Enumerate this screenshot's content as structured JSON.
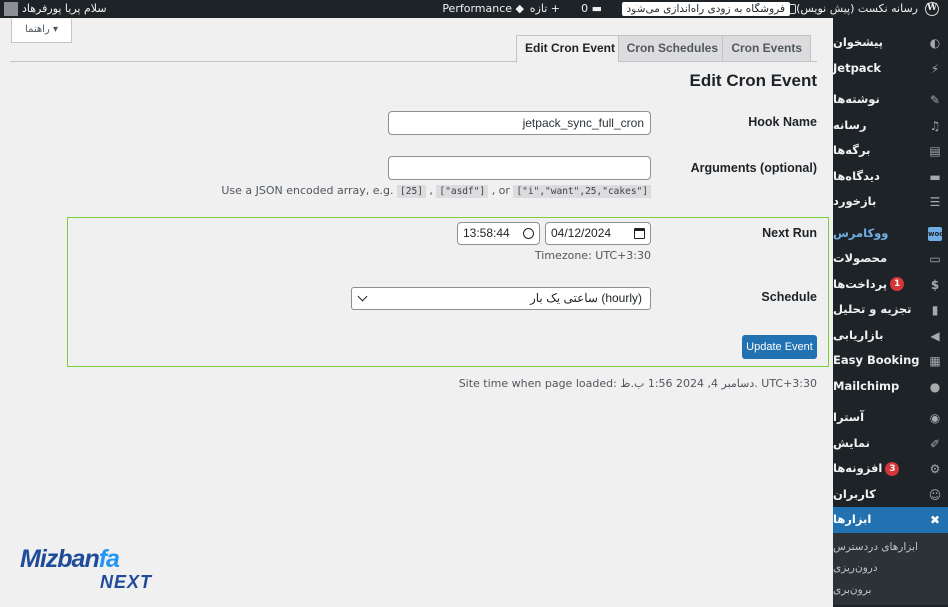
{
  "adminbar": {
    "site_name": "رسانه نکست (پیش نویس)",
    "store_notice": "فروشگاه به زودی راه‌اندازی می‌شود",
    "updates_count": "7",
    "comments_count": "0",
    "new_label": "تازه",
    "performance_label": "Performance",
    "greeting": "سلام پریا پورفرهاد"
  },
  "help_tab_label": "راهنما ▾",
  "tabs": [
    {
      "label": "Edit Cron Event",
      "active": true
    },
    {
      "label": "Cron Schedules",
      "active": false
    },
    {
      "label": "Cron Events",
      "active": false
    }
  ],
  "page_title": "Edit Cron Event",
  "form": {
    "hook_name_label": "Hook Name",
    "hook_name_value": "jetpack_sync_full_cron",
    "arguments_label": "Arguments (optional)",
    "arguments_value": "",
    "arguments_desc_prefix": "Use a JSON encoded array, e.g.",
    "arguments_ex1": "[25]",
    "arguments_ex2": "[\"asdf\"]",
    "arguments_ex3": "[\"i\",\"want\",25,\"cakes\"]",
    "arguments_sep1": ",",
    "arguments_sep2": ", or",
    "next_run_label": "Next Run",
    "next_run_date": "04/12/2024",
    "next_run_time": "13:58:44",
    "timezone_text": "Timezone: UTC+3:30",
    "schedule_label": "Schedule",
    "schedule_value": "ساعتی یک بار (hourly)",
    "update_button": "Update Event"
  },
  "site_time": "Site time when page loaded: دسامبر 4, 2024 1:56 ب.ظ. UTC+3:30",
  "sidebar": {
    "items": [
      {
        "label": "پیشخوان",
        "icon": "dashboard-icon"
      },
      {
        "label": "Jetpack",
        "icon": "jetpack-icon"
      },
      {
        "label": "نوشته‌ها",
        "icon": "pin-icon"
      },
      {
        "label": "رسانه",
        "icon": "media-icon"
      },
      {
        "label": "برگه‌ها",
        "icon": "pages-icon"
      },
      {
        "label": "دیدگاه‌ها",
        "icon": "comments-icon"
      },
      {
        "label": "بازخورد",
        "icon": "feedback-icon"
      },
      {
        "label": "ووکامرس",
        "icon": "woo-icon"
      },
      {
        "label": "محصولات",
        "icon": "products-icon"
      },
      {
        "label": "پرداخت‌ها",
        "icon": "payments-icon",
        "badge": "1"
      },
      {
        "label": "تجزیه و تحلیل",
        "icon": "analytics-icon"
      },
      {
        "label": "بازاریابی",
        "icon": "marketing-icon"
      },
      {
        "label": "Easy Booking",
        "icon": "calendar-icon"
      },
      {
        "label": "Mailchimp",
        "icon": "mailchimp-icon"
      },
      {
        "label": "آسترا",
        "icon": "astra-icon"
      },
      {
        "label": "نمایش",
        "icon": "appearance-icon"
      },
      {
        "label": "افزونه‌ها",
        "icon": "plugins-icon",
        "badge": "3"
      },
      {
        "label": "کاربران",
        "icon": "users-icon"
      },
      {
        "label": "ابزارها",
        "icon": "tools-icon"
      }
    ],
    "submenu": [
      "ابزارهای دردسترس",
      "درون‌ریزی",
      "برون‌بری"
    ]
  },
  "logo": {
    "line1_a": "Mizban",
    "line1_b": "fa",
    "line2": "NEXT"
  }
}
